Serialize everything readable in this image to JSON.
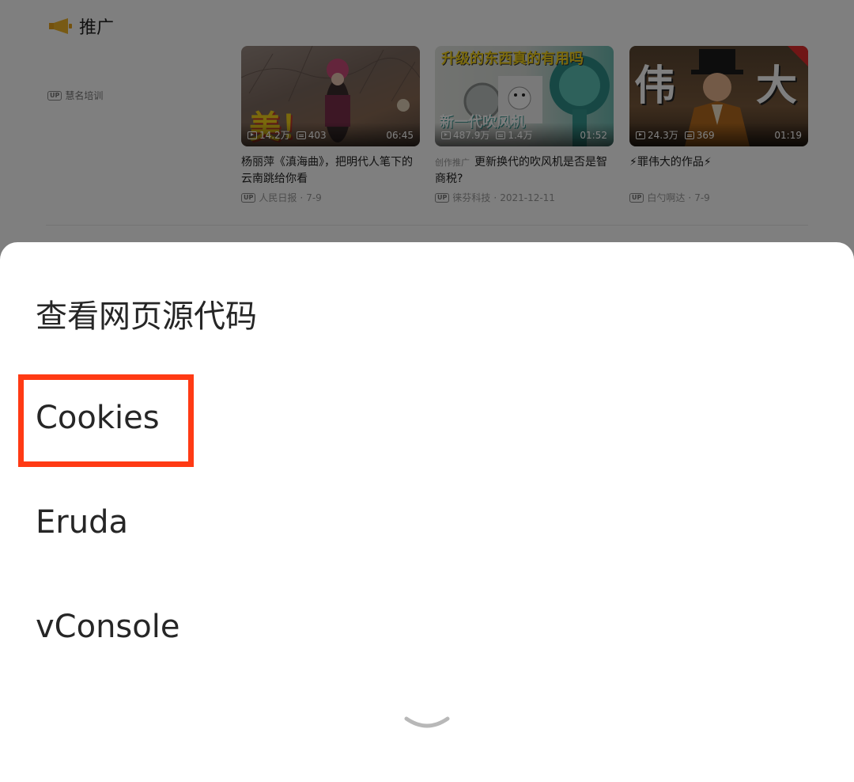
{
  "background": {
    "section_title": "推广",
    "advertiser_badge": "UP",
    "advertiser_name": "慧名培训",
    "cards": [
      {
        "thumb_text": "美！",
        "views": "14.2万",
        "danmaku": "403",
        "duration": "06:45",
        "title": "杨丽萍《滇海曲》，把明代人笔下的云南跳给你看",
        "promo_tag": "",
        "up_badge": "UP",
        "author": "人民日报",
        "date": "7-9"
      },
      {
        "thumb_text": "升级的东西真的有用吗",
        "thumb_text2": "新一代吹风机",
        "views": "487.9万",
        "danmaku": "1.4万",
        "duration": "01:52",
        "title": "更新换代的吹风机是否是智商税?",
        "promo_tag": "创作推广",
        "up_badge": "UP",
        "author": "徕芬科技",
        "date": "2021-12-11"
      },
      {
        "thumb_text": "伟",
        "thumb_text2": "大",
        "views": "24.3万",
        "danmaku": "369",
        "duration": "01:19",
        "title": "⚡罪伟大的作品⚡",
        "promo_tag": "",
        "up_badge": "UP",
        "author": "白勺啊达",
        "date": "7-9"
      }
    ]
  },
  "menu": {
    "items": [
      {
        "label": "查看网页源代码"
      },
      {
        "label": "Cookies"
      },
      {
        "label": "Eruda"
      },
      {
        "label": "vConsole"
      }
    ],
    "highlight_color": "#ff3a14"
  },
  "icons": {
    "section": "megaphone-icon",
    "views": "play-icon",
    "danmaku": "danmaku-icon",
    "collapse": "chevron-down-icon"
  }
}
